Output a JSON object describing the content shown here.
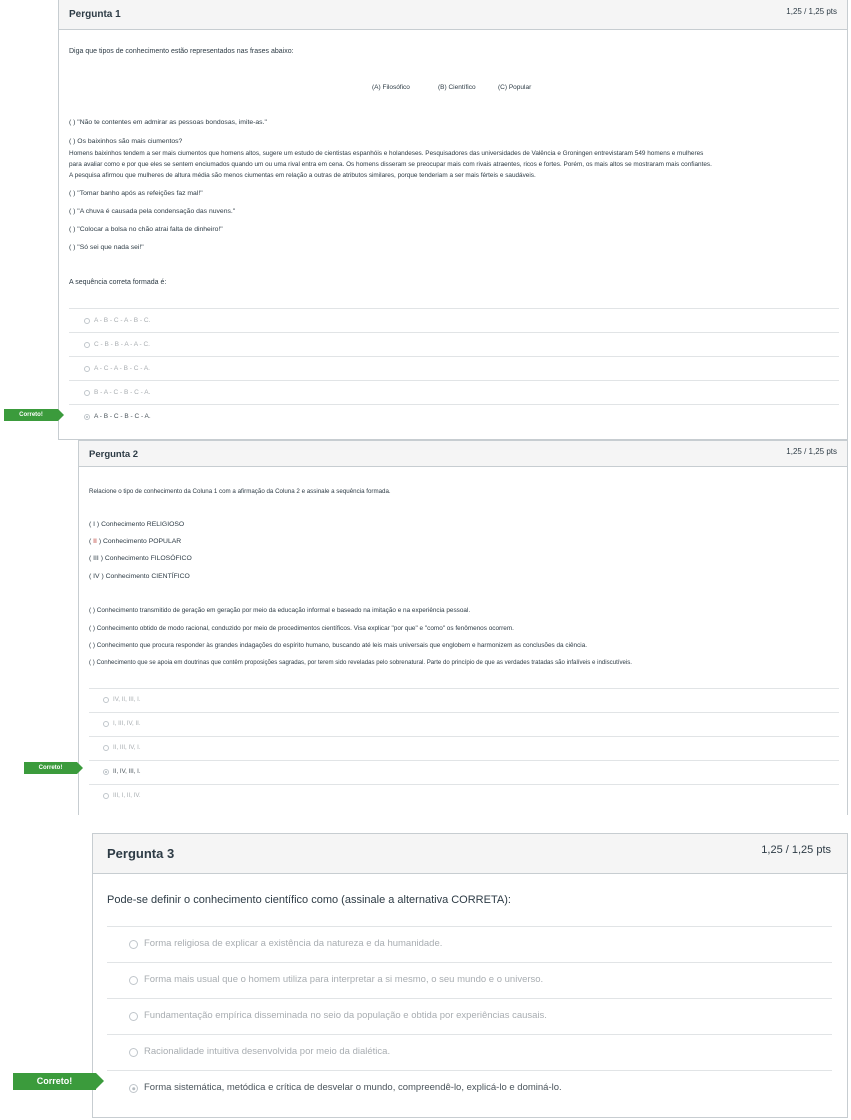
{
  "q1": {
    "title": "Pergunta 1",
    "points": "1,25 / 1,25 pts",
    "prompt": "Diga que tipos de conhecimento estão representados nas frases abaixo:",
    "legend": {
      "a": "(A) Filosófico",
      "b": "(B) Científico",
      "c": "(C) Popular"
    },
    "item1": "(   ) \"Não te contentes em admirar as pessoas bondosas, imite-as.\"",
    "item2_title": "(   ) Os baixinhos são mais ciumentos?",
    "item2_line1": "Homens baixinhos tendem a ser mais ciumentos que homens altos, sugere um estudo de cientistas espanhóis e holandeses. Pesquisadores das universidades de Valência e Groningen entrevistaram 549 homens e mulheres",
    "item2_line2": "para avaliar como e por que eles se sentem enciumados quando um ou uma rival entra em cena. Os homens disseram se preocupar mais com rivais atraentes, ricos e fortes. Porém, os mais altos se mostraram mais confiantes.",
    "item2_line3": "A pesquisa afirmou que mulheres de altura média são menos ciumentas em relação a outras de atributos similares, porque tenderiam a ser mais férteis e saudáveis.",
    "item3": "(   ) \"Tomar banho após as refeições faz mal!\"",
    "item4": "(   ) \"A chuva é causada pela condensação das nuvens.\"",
    "item5": "(   ) \"Colocar a bolsa no chão atrai falta de dinheiro!\"",
    "item6": "(   ) \"Só sei que nada sei!\"",
    "question": "A sequência correta formada é:",
    "answers": [
      "A - B - C - A - B - C.",
      "C - B - B - A - A - C.",
      "A - C - A - B - C - A.",
      "B - A - C - B - C - A.",
      "A - B - C - B - C - A."
    ],
    "selected_index": 4,
    "flag": "Correto!"
  },
  "q2": {
    "title": "Pergunta 2",
    "points": "1,25 / 1,25 pts",
    "prompt": "Relacione o tipo de conhecimento da Coluna 1 com a afirmação da Coluna 2 e assinale a sequência formada.",
    "col1": {
      "i": "( I ) Conhecimento RELIGIOSO",
      "ii_open": "( ",
      "ii_mark": "II",
      "ii_rest": " ) Conhecimento POPULAR",
      "iii": "( III ) Conhecimento FILOSÓFICO",
      "iv": "( IV ) Conhecimento CIENTÍFICO"
    },
    "col2": [
      "(   ) Conhecimento transmitido de geração em geração por meio da educação informal e baseado na imitação e na experiência pessoal.",
      "(   ) Conhecimento obtido de modo racional, conduzido por meio de procedimentos científicos. Visa explicar \"por que\" e \"como\" os fenômenos ocorrem.",
      "(   ) Conhecimento que procura responder às grandes indagações do espírito humano, buscando até leis mais universais que englobem e harmonizem as conclusões da ciência.",
      "(   ) Conhecimento que se apoia em doutrinas que contêm proposições sagradas, por terem sido reveladas pelo sobrenatural. Parte do princípio de que as verdades tratadas são infalíveis e indiscutíveis."
    ],
    "answers": [
      "IV, II, III, I.",
      "I, III, IV, II.",
      "II, III, IV, I.",
      "II, IV, III, I.",
      "III, I, II, IV."
    ],
    "selected_index": 3,
    "flag": "Correto!"
  },
  "q3": {
    "title": "Pergunta 3",
    "points": "1,25 / 1,25 pts",
    "prompt": "Pode-se definir o conhecimento científico como (assinale a alternativa CORRETA):",
    "answers": [
      "Forma religiosa de explicar a existência da natureza e da humanidade.",
      "Forma mais usual que o homem utiliza para interpretar a si mesmo, o seu mundo e o universo.",
      "Fundamentação empírica disseminada no seio da população e obtida por experiências causais.",
      "Racionalidade intuitiva desenvolvida por meio da dialética.",
      "Forma sistemática, metódica e crítica de desvelar o mundo, compreendê-lo, explicá-lo e dominá-lo."
    ],
    "selected_index": 4,
    "flag": "Correto!"
  }
}
